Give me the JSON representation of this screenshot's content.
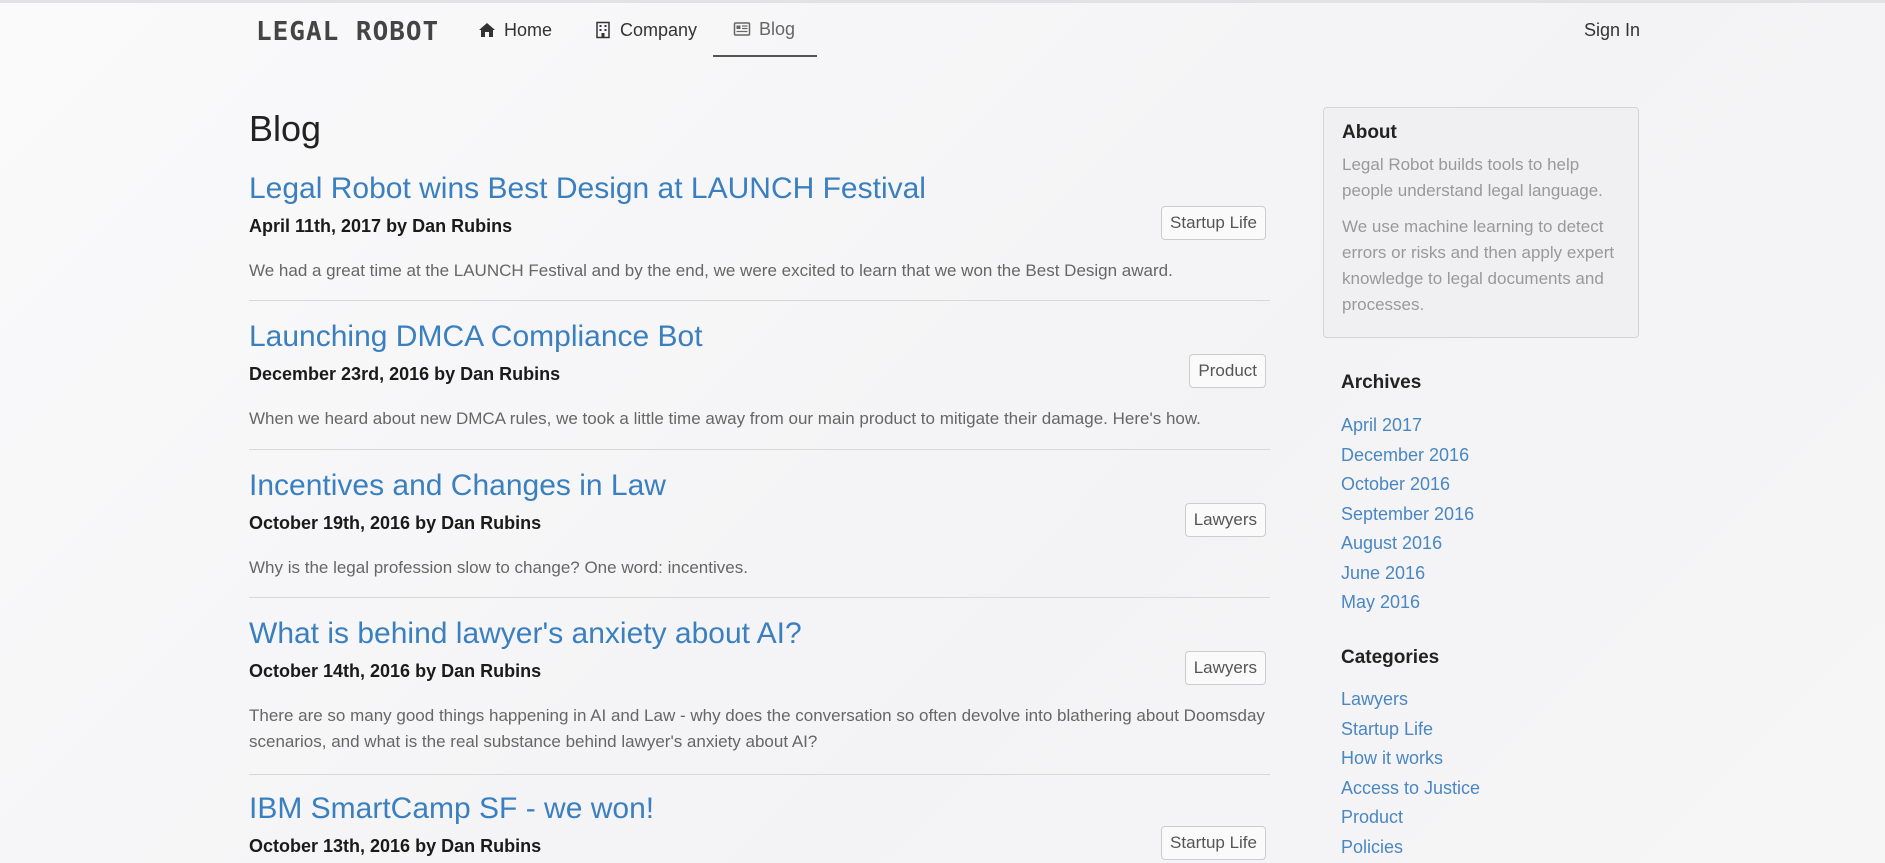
{
  "nav": {
    "brand": "LEGAL ROBOT",
    "items": [
      {
        "label": "Home",
        "icon": "home-icon"
      },
      {
        "label": "Company",
        "icon": "building-icon"
      },
      {
        "label": "Blog",
        "icon": "newspaper-icon",
        "active": true
      }
    ],
    "sign_in": "Sign In"
  },
  "main": {
    "title": "Blog",
    "posts": [
      {
        "title": "Legal Robot wins Best Design at LAUNCH Festival",
        "meta": "April 11th, 2017 by Dan Rubins",
        "tag": "Startup Life",
        "excerpt": "We had a great time at the LAUNCH Festival and by the end, we were excited to learn that we won the Best Design award."
      },
      {
        "title": "Launching DMCA Compliance Bot",
        "meta": "December 23rd, 2016 by Dan Rubins",
        "tag": "Product",
        "excerpt": "When we heard about new DMCA rules, we took a little time away from our main product to mitigate their damage. Here's how."
      },
      {
        "title": "Incentives and Changes in Law",
        "meta": "October 19th, 2016 by Dan Rubins",
        "tag": "Lawyers",
        "excerpt": "Why is the legal profession slow to change? One word: incentives."
      },
      {
        "title": "What is behind lawyer's anxiety about AI?",
        "meta": "October 14th, 2016 by Dan Rubins",
        "tag": "Lawyers",
        "excerpt": "There are so many good things happening in AI and Law - why does the conversation so often devolve into blathering about Doomsday scenarios, and what is the real substance behind lawyer's anxiety about AI?"
      },
      {
        "title": "IBM SmartCamp SF - we won!",
        "meta": "October 13th, 2016 by Dan Rubins",
        "tag": "Startup Life",
        "excerpt": ""
      }
    ]
  },
  "sidebar": {
    "about": {
      "title": "About",
      "p1": "Legal Robot builds tools to help people understand legal language.",
      "p2": "We use machine learning to detect errors or risks and then apply expert knowledge to legal documents and processes."
    },
    "archives": {
      "title": "Archives",
      "items": [
        "April 2017",
        "December 2016",
        "October 2016",
        "September 2016",
        "August 2016",
        "June 2016",
        "May 2016"
      ]
    },
    "categories": {
      "title": "Categories",
      "items": [
        "Lawyers",
        "Startup Life",
        "How it works",
        "Access to Justice",
        "Product",
        "Policies"
      ]
    }
  },
  "colors": {
    "link": "#3a7fbf",
    "muted_text": "#999999",
    "background": "#f7f7f8"
  }
}
